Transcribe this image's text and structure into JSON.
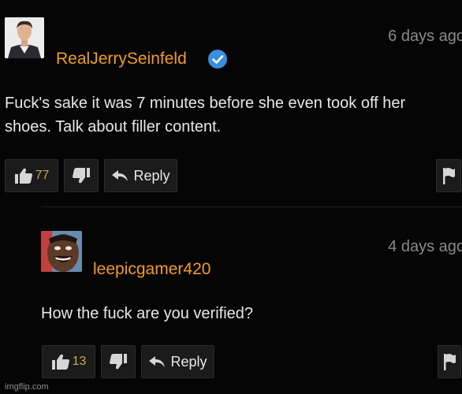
{
  "comments": [
    {
      "username": "RealJerrySeinfeld",
      "verified": true,
      "time": "6 days ago",
      "text": "Fuck's sake it was 7 minutes before she even took off her shoes. Talk about filler content.",
      "likes": "77",
      "reply_label": "Reply"
    },
    {
      "username": "leepicgamer420",
      "time": "4 days ago",
      "text": "How the fuck are you verified?",
      "likes": "13",
      "reply_label": "Reply"
    }
  ],
  "watermark": "imgflip.com",
  "colors": {
    "background": "#050505",
    "username": "#f19c26",
    "like_count": "#c9a74a",
    "verified_badge": "#3a8de0",
    "timestamp": "#8a8a8a"
  },
  "icons": [
    "verified-badge-icon",
    "thumbs-up-icon",
    "thumbs-down-icon",
    "reply-arrow-icon",
    "flag-icon"
  ]
}
